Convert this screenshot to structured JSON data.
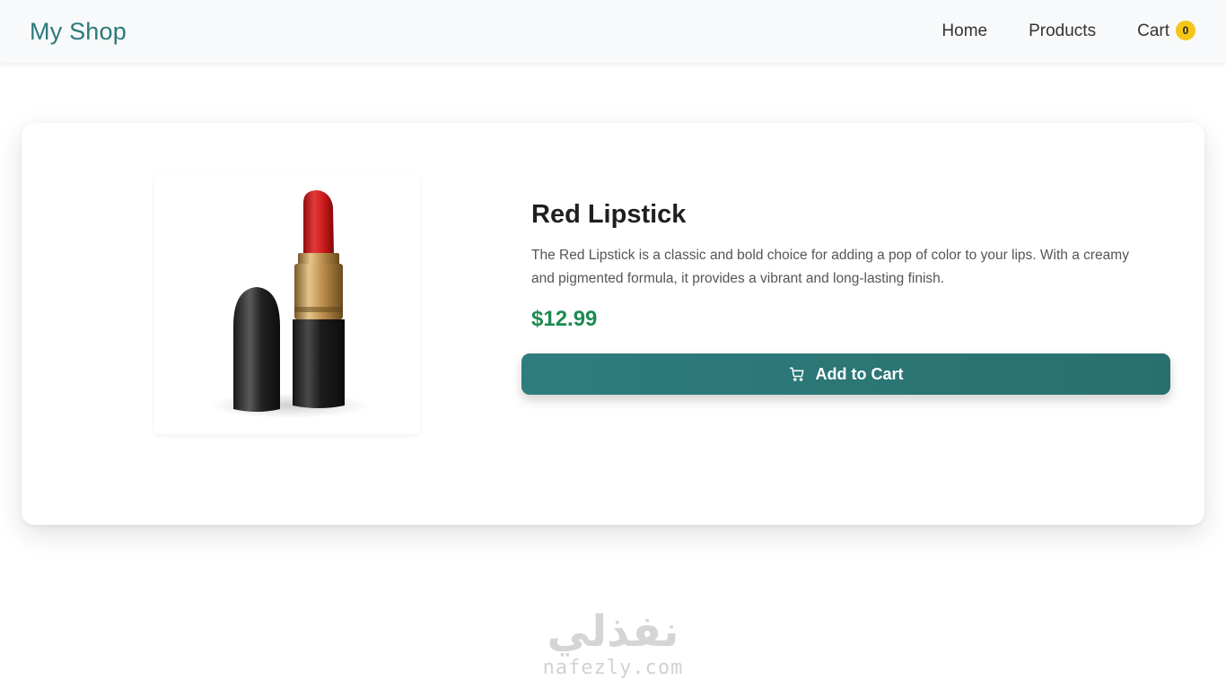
{
  "navbar": {
    "brand": "My Shop",
    "links": [
      {
        "label": "Home"
      },
      {
        "label": "Products"
      },
      {
        "label": "Cart",
        "badge": "0"
      }
    ]
  },
  "product": {
    "image_icon": "lipstick-image",
    "title": "Red Lipstick",
    "description": "The Red Lipstick is a classic and bold choice for adding a pop of color to your lips. With a creamy and pigmented formula, it provides a vibrant and long-lasting finish.",
    "price": "$12.99",
    "add_to_cart_label": "Add to Cart",
    "add_to_cart_icon": "cart-icon"
  },
  "watermark": {
    "arabic": "نفذلي",
    "latin": "nafezly.com"
  },
  "colors": {
    "brand": "#2a7a7b",
    "button": "#2e7d7d",
    "price": "#1e8a52",
    "badge": "#f5c518"
  }
}
